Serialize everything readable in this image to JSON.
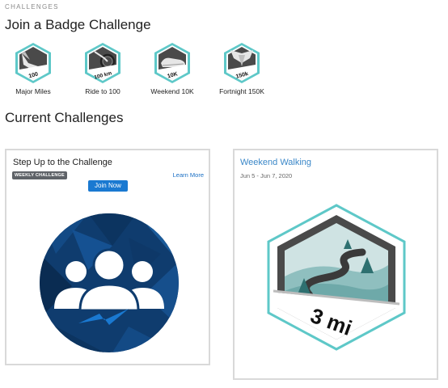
{
  "breadcrumb": "CHALLENGES",
  "join_heading": "Join a Badge Challenge",
  "badges": [
    {
      "label": "Major Miles",
      "badge_text": "100",
      "icon": "winged-shoe-icon"
    },
    {
      "label": "Ride to 100",
      "badge_text": "100 km",
      "icon": "bicycle-icon"
    },
    {
      "label": "Weekend 10K",
      "badge_text": "10K",
      "icon": "running-shoe-icon"
    },
    {
      "label": "Fortnight 150K",
      "badge_text": "150k",
      "icon": "winged-emblem-icon"
    }
  ],
  "current_heading": "Current Challenges",
  "cards": [
    {
      "title": "Step Up to the Challenge",
      "tag": "WEEKLY CHALLENGE",
      "learn_more": "Learn More",
      "join_button": "Join Now",
      "image_icon": "group-people-icon"
    },
    {
      "title": "Weekend Walking",
      "dates": "Jun 5 - Jun 7, 2020",
      "badge_text": "3 mi",
      "image_icon": "winding-road-badge-icon"
    }
  ],
  "colors": {
    "accent_blue": "#1a79d1",
    "link_blue": "#3a87c8",
    "badge_teal": "#5ec8c8",
    "badge_dark": "#4a4a4a",
    "circle_navy": "#0f3c6e"
  }
}
